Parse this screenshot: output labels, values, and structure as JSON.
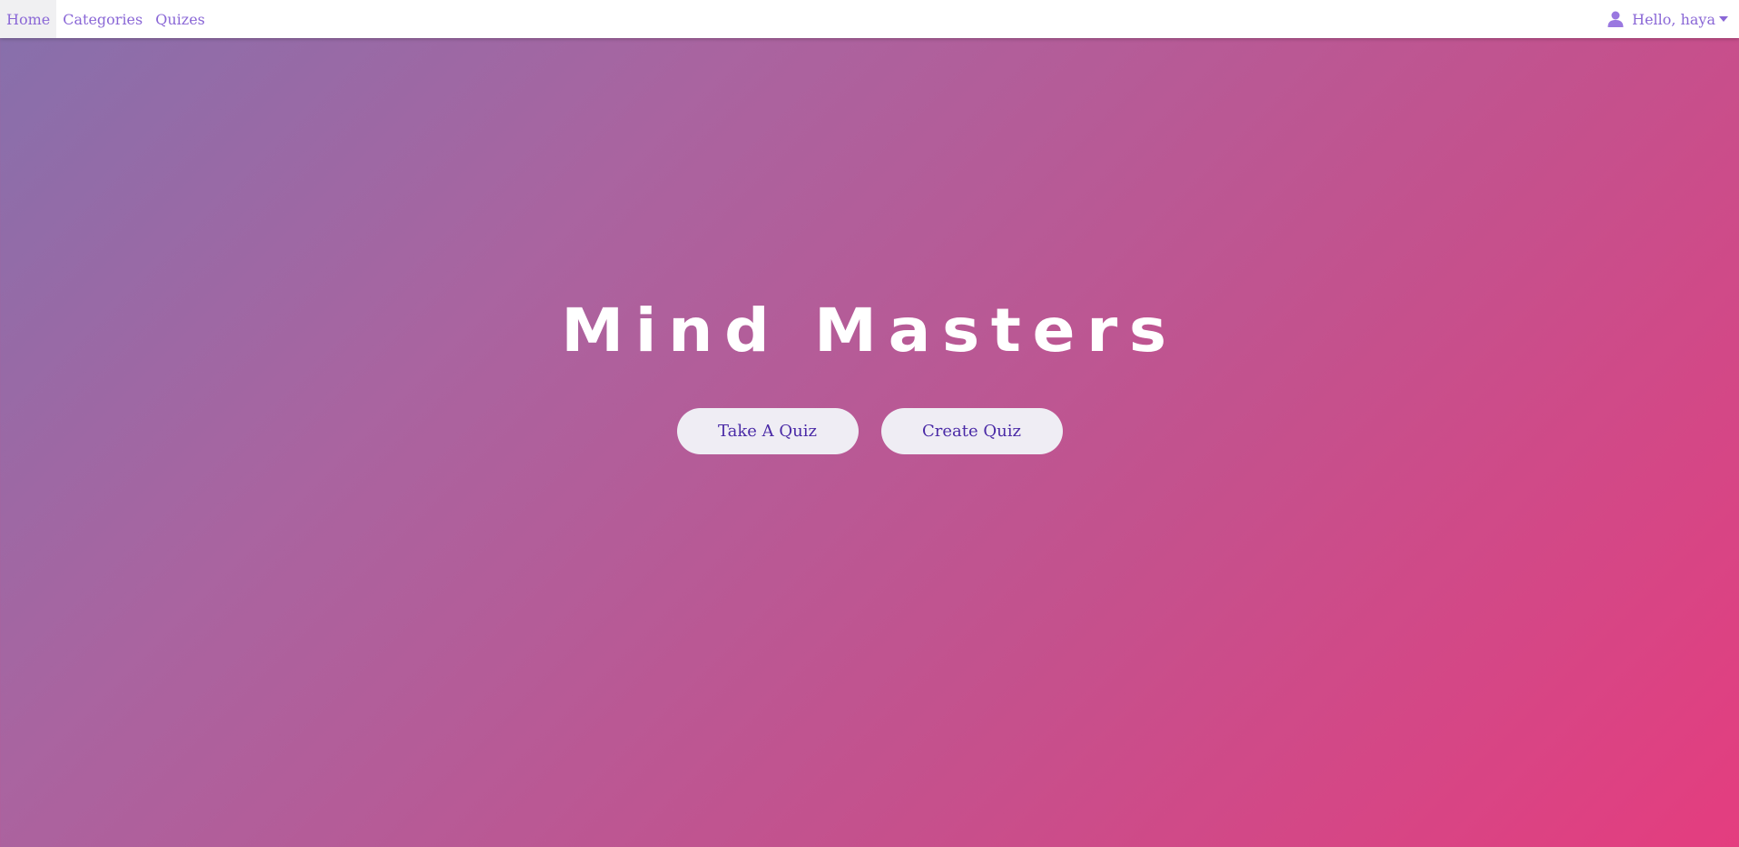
{
  "nav": {
    "items": [
      {
        "label": "Home",
        "active": true
      },
      {
        "label": "Categories",
        "active": false
      },
      {
        "label": "Quizes",
        "active": false
      }
    ],
    "user_greeting": "Hello, haya",
    "user_icon": "user-icon",
    "caret_icon": "caret-down-icon"
  },
  "hero": {
    "title": "Mind Masters",
    "buttons": {
      "take_quiz": "Take A Quiz",
      "create_quiz": "Create Quiz"
    }
  },
  "colors": {
    "accent": "#8a67d6",
    "button_text": "#4a2aa6",
    "button_bg": "#efedf4",
    "gradient_start": "#8670ac",
    "gradient_end": "#e43d7f"
  }
}
